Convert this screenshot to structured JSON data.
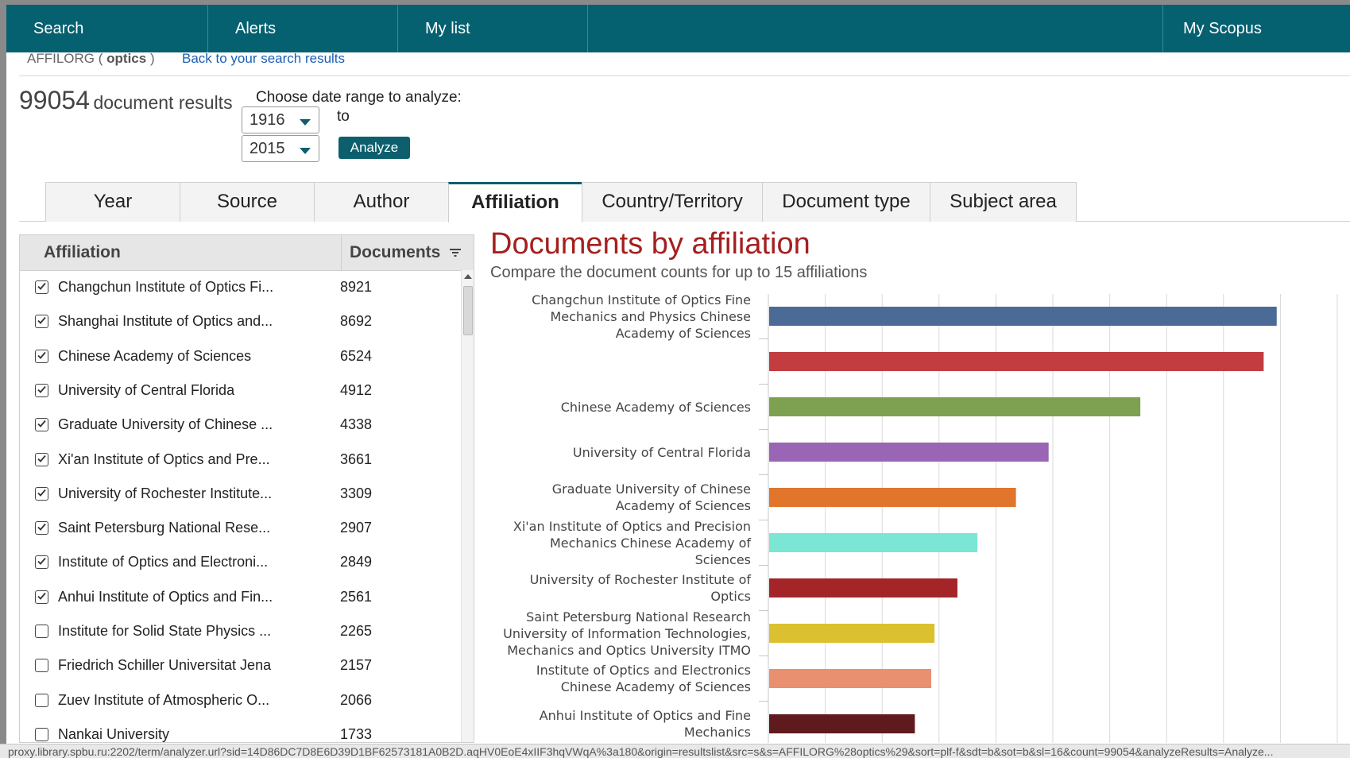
{
  "nav": {
    "items": [
      "Search",
      "Alerts",
      "My list"
    ],
    "right_item": "My Scopus",
    "bg_color": "#05606f"
  },
  "query": {
    "prefix": "AFFILORG (",
    "term": "optics",
    "suffix": ")",
    "back_link": "Back to your search results"
  },
  "results": {
    "count": "99054",
    "label": "document results"
  },
  "date_range": {
    "label": "Choose date range to analyze:",
    "from": "1916",
    "to_label": "to",
    "to": "2015",
    "button": "Analyze"
  },
  "tabs": [
    {
      "label": "Year",
      "active": false
    },
    {
      "label": "Source",
      "active": false
    },
    {
      "label": "Author",
      "active": false
    },
    {
      "label": "Affiliation",
      "active": true
    },
    {
      "label": "Country/Territory",
      "active": false
    },
    {
      "label": "Document type",
      "active": false
    },
    {
      "label": "Subject area",
      "active": false
    }
  ],
  "table": {
    "headers": {
      "affiliation": "Affiliation",
      "documents": "Documents"
    },
    "rows": [
      {
        "name": "Changchun Institute of Optics Fi...",
        "count": "8921",
        "checked": true
      },
      {
        "name": "Shanghai Institute of Optics and...",
        "count": "8692",
        "checked": true
      },
      {
        "name": "Chinese Academy of Sciences",
        "count": "6524",
        "checked": true
      },
      {
        "name": "University of Central Florida",
        "count": "4912",
        "checked": true
      },
      {
        "name": "Graduate University of Chinese ...",
        "count": "4338",
        "checked": true
      },
      {
        "name": "Xi'an Institute of Optics and Pre...",
        "count": "3661",
        "checked": true
      },
      {
        "name": "University of Rochester Institute...",
        "count": "3309",
        "checked": true
      },
      {
        "name": "Saint Petersburg National Rese...",
        "count": "2907",
        "checked": true
      },
      {
        "name": "Institute of Optics and Electroni...",
        "count": "2849",
        "checked": true
      },
      {
        "name": "Anhui Institute of Optics and Fin...",
        "count": "2561",
        "checked": true
      },
      {
        "name": "Institute for Solid State Physics ...",
        "count": "2265",
        "checked": false
      },
      {
        "name": "Friedrich Schiller Universitat Jena",
        "count": "2157",
        "checked": false
      },
      {
        "name": "Zuev Institute of Atmospheric O...",
        "count": "2066",
        "checked": false
      },
      {
        "name": "Nankai University",
        "count": "1733",
        "checked": false
      }
    ]
  },
  "chart_data": {
    "type": "bar",
    "orientation": "horizontal",
    "title": "Documents by affiliation",
    "subtitle": "Compare the document counts for up to 15 affiliations",
    "categories": [
      [
        "Changchun Institute of Optics Fine",
        "Mechanics and Physics Chinese",
        "Academy of Sciences"
      ],
      [],
      [
        "Chinese Academy of Sciences"
      ],
      [
        "University of Central Florida"
      ],
      [
        "Graduate University of Chinese",
        "Academy of Sciences"
      ],
      [
        "Xi'an Institute of Optics and Precision",
        "Mechanics Chinese Academy of",
        "Sciences"
      ],
      [
        "University of Rochester Institute of",
        "Optics"
      ],
      [
        "Saint Petersburg National Research",
        "University of Information Technologies,",
        "Mechanics and Optics University ITMO"
      ],
      [
        "Institute of Optics and Electronics",
        "Chinese Academy of Sciences"
      ],
      [
        "Anhui Institute of Optics and Fine",
        "Mechanics"
      ]
    ],
    "values": [
      8921,
      8692,
      6524,
      4912,
      4338,
      3661,
      3309,
      2907,
      2849,
      2561
    ],
    "colors": [
      "#4b6a96",
      "#c23c40",
      "#7ea151",
      "#9965b4",
      "#e0752b",
      "#7ae6d3",
      "#a32528",
      "#dbc12f",
      "#e89070",
      "#5e1a1c"
    ],
    "xlim": [
      0,
      10000
    ],
    "grid": true
  },
  "status_url": "proxy.library.spbu.ru:2202/term/analyzer.url?sid=14D86DC7D8E6D39D1BF62573181A0B2D.aqHV0EoE4xIIF3hqVWqA%3a180&origin=resultslist&src=s&s=AFFILORG%28optics%29&sort=plf-f&sdt=b&sot=b&sl=16&count=99054&analyzeResults=Analyze..."
}
